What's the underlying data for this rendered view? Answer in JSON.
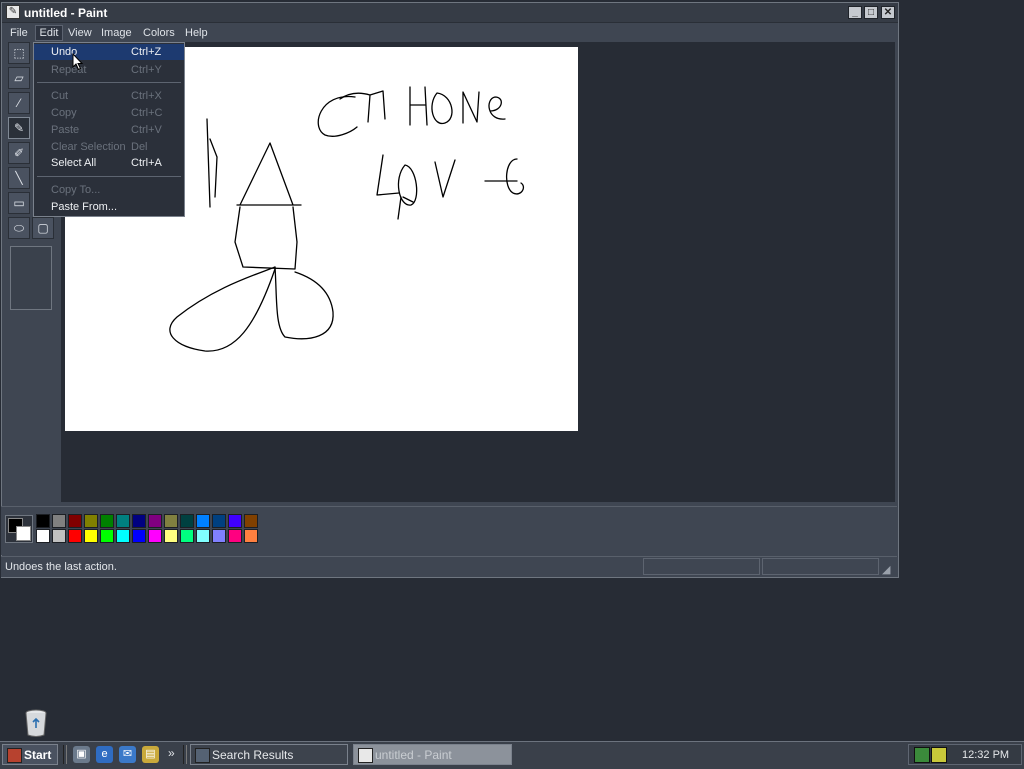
{
  "window": {
    "title": "untitled - Paint",
    "controls": {
      "minimize": "_",
      "maximize": "□",
      "close": "✕"
    }
  },
  "menubar": [
    "File",
    "Edit",
    "View",
    "Image",
    "Colors",
    "Help"
  ],
  "edit_menu": {
    "items": [
      {
        "label": "Undo",
        "shortcut": "Ctrl+Z",
        "enabled": true,
        "highlighted": true
      },
      {
        "label": "Repeat",
        "shortcut": "Ctrl+Y",
        "enabled": false
      },
      {
        "label": "Cut",
        "shortcut": "Ctrl+X",
        "enabled": false
      },
      {
        "label": "Copy",
        "shortcut": "Ctrl+C",
        "enabled": false
      },
      {
        "label": "Paste",
        "shortcut": "Ctrl+V",
        "enabled": false
      },
      {
        "label": "Clear Selection",
        "shortcut": "Del",
        "enabled": false
      },
      {
        "label": "Select All",
        "shortcut": "Ctrl+A",
        "enabled": true
      },
      {
        "label": "Copy To...",
        "shortcut": "",
        "enabled": false
      },
      {
        "label": "Paste From...",
        "shortcut": "",
        "enabled": true
      }
    ]
  },
  "tools": [
    "free-select-icon",
    "eraser-icon",
    "color-picker-icon",
    "pencil-icon",
    "brush-icon",
    "line-icon",
    "rectangle-icon",
    "ellipse-icon",
    "rounded-rect-icon"
  ],
  "palette": {
    "row1": [
      "#000000",
      "#808080",
      "#800000",
      "#808000",
      "#008000",
      "#008080",
      "#000080",
      "#800080",
      "#808040",
      "#004040",
      "#0080ff",
      "#004080",
      "#4000ff",
      "#804000"
    ],
    "row2": [
      "#ffffff",
      "#c0c0c0",
      "#ff0000",
      "#ffff00",
      "#00ff00",
      "#00ffff",
      "#0000ff",
      "#ff00ff",
      "#ffff80",
      "#00ff80",
      "#80ffff",
      "#8080ff",
      "#ff0080",
      "#ff8040"
    ],
    "foreground": "#000000",
    "background": "#ffffff"
  },
  "status": {
    "text": "Undoes the last action."
  },
  "taskbar": {
    "start": "Start",
    "quicklaunch_more": "»",
    "tasks": [
      {
        "label": "Search Results",
        "active": false
      },
      {
        "label": "untitled - Paint",
        "active": true
      }
    ],
    "clock": "12:32 PM"
  }
}
